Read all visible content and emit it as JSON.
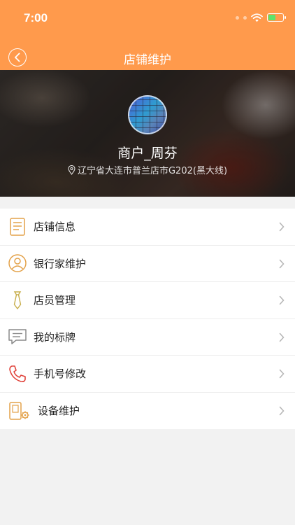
{
  "status": {
    "time": "7:00"
  },
  "header": {
    "title": "店铺维护"
  },
  "profile": {
    "name": "商户_周芬",
    "address": "辽宁省大连市普兰店市G202(黑大线)"
  },
  "menu": {
    "items": [
      {
        "label": "店铺信息",
        "icon": "store-info-icon"
      },
      {
        "label": "银行家维护",
        "icon": "person-icon"
      },
      {
        "label": "店员管理",
        "icon": "tie-icon"
      },
      {
        "label": "我的标牌",
        "icon": "message-sign-icon"
      },
      {
        "label": "手机号修改",
        "icon": "phone-icon"
      },
      {
        "label": "设备维护",
        "icon": "device-gear-icon"
      }
    ]
  },
  "colors": {
    "accent": "#ff9a4c",
    "icon": "#e3a24a",
    "phone_icon": "#e0443c"
  }
}
